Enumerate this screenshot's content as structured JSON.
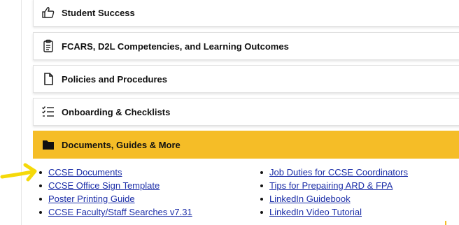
{
  "accordion": [
    {
      "label": "Student Success",
      "icon": "thumbs-up-icon"
    },
    {
      "label": "FCARS, D2L Competencies, and Learning Outcomes",
      "icon": "clipboard-list-icon"
    },
    {
      "label": "Policies and Procedures",
      "icon": "document-icon"
    },
    {
      "label": "Onboarding & Checklists",
      "icon": "checklist-icon"
    },
    {
      "label": "Documents, Guides & More",
      "icon": "folder-icon"
    }
  ],
  "links_left": [
    "CCSE Documents",
    "CCSE Office Sign Template",
    "Poster Printing Guide",
    "CCSE Faculty/Staff Searches v7.31"
  ],
  "links_right": [
    "Job Duties for CCSE Coordinators",
    "Tips for Prepairing ARD & FPA",
    "LinkedIn Guidebook",
    "LinkedIn Video Tutorial"
  ],
  "colors": {
    "accent": "#f5bd27",
    "link": "#1d2fa8",
    "arrow": "#f5d90a"
  },
  "annotation": {
    "icon": "yellow-arrow-icon"
  }
}
